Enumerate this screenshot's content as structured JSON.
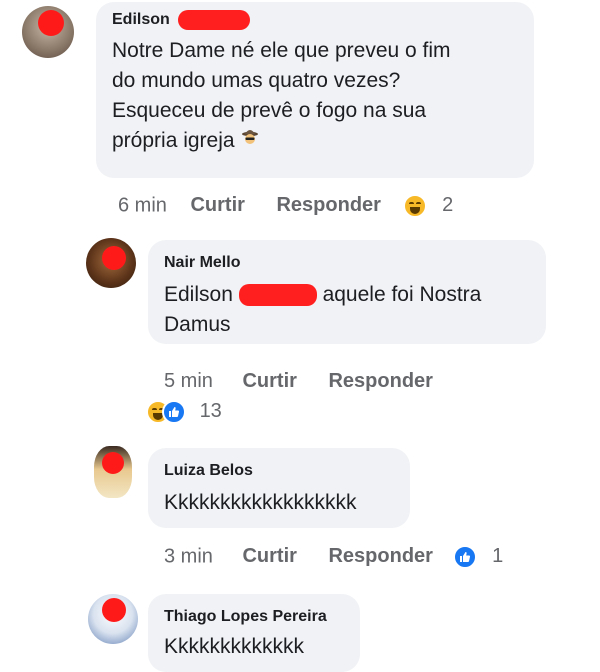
{
  "comments": [
    {
      "author": "Edilson",
      "text_lines": [
        "Notre Dame né ele que preveu o fim",
        "do mundo umas quatro vezes?",
        "Esqueceu de prevê o fogo na sua",
        "própria igreja"
      ],
      "emoji_icon": "spy-icon",
      "time": "6 min",
      "like_label": "Curtir",
      "reply_label": "Responder",
      "reaction_icon": "haha-icon",
      "reaction_count": "2"
    },
    {
      "author": "Nair Mello",
      "text_start": "Edilson",
      "text_end": "aquele foi Nostra",
      "text_line2": "Damus",
      "time": "5 min",
      "like_label": "Curtir",
      "reply_label": "Responder",
      "reaction_icons": [
        "haha-icon",
        "like-icon"
      ],
      "reaction_count": "13"
    },
    {
      "author": "Luiza Belos",
      "text": "Kkkkkkkkkkkkkkkkkk",
      "time": "3 min",
      "like_label": "Curtir",
      "reply_label": "Responder",
      "reaction_icon": "like-icon",
      "reaction_count": "1"
    },
    {
      "author": "Thiago Lopes Pereira",
      "text": "Kkkkkkkkkkkkk"
    }
  ],
  "colors": {
    "bubble": "#f0f2f5",
    "meta": "#65676b",
    "redaction": "#ff1f1f",
    "like_blue": "#1877f2",
    "haha_yellow": "#f7b928"
  }
}
